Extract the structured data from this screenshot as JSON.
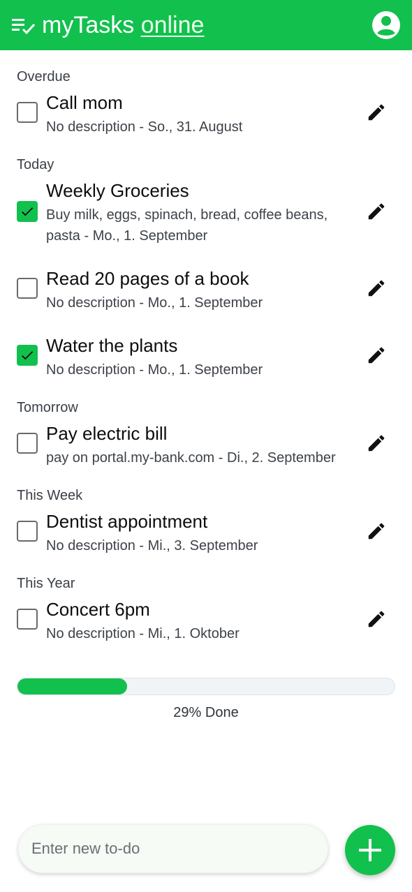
{
  "app": {
    "title_main": "myTasks",
    "title_status": "online",
    "accent_color": "#12c04e",
    "icons": {
      "menu": "playlist-check-icon",
      "account": "account-circle-icon"
    }
  },
  "sections": [
    {
      "label": "Overdue",
      "tasks": [
        {
          "title": "Call mom",
          "description": "No description - So., 31. August",
          "checked": false
        }
      ]
    },
    {
      "label": "Today",
      "tasks": [
        {
          "title": "Weekly Groceries",
          "description": "Buy milk, eggs, spinach, bread, coffee beans, pasta - Mo., 1. September",
          "checked": true
        },
        {
          "title": "Read 20 pages of a book",
          "description": "No description - Mo., 1. September",
          "checked": false
        },
        {
          "title": "Water the plants",
          "description": "No description - Mo., 1. September",
          "checked": true
        }
      ]
    },
    {
      "label": "Tomorrow",
      "tasks": [
        {
          "title": "Pay electric bill",
          "description": "pay on portal.my-bank.com - Di., 2. September",
          "checked": false
        }
      ]
    },
    {
      "label": "This Week",
      "tasks": [
        {
          "title": "Dentist appointment",
          "description": "No description - Mi., 3. September",
          "checked": false
        }
      ]
    },
    {
      "label": "This Year",
      "tasks": [
        {
          "title": "Concert 6pm",
          "description": "No description - Mi., 1. Oktober",
          "checked": false
        }
      ]
    }
  ],
  "progress": {
    "percent": 29,
    "label": "29% Done"
  },
  "new_todo": {
    "placeholder": "Enter new to-do",
    "value": "",
    "add_icon": "plus-icon"
  }
}
